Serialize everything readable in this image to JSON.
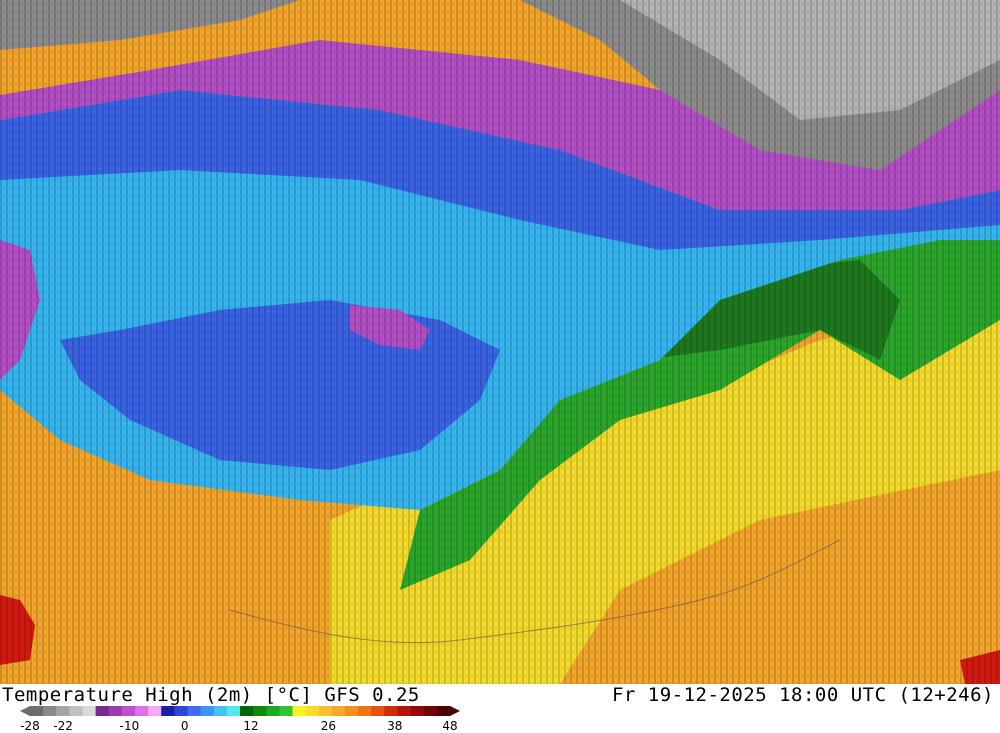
{
  "map": {
    "title": "Temperature High (2m) [°C] GFS 0.25",
    "datetime": "Fr 19-12-2025 18:00 UTC (12+246)"
  },
  "legend": {
    "tick_labels": [
      "-28",
      "-22",
      "-10",
      "0",
      "12",
      "26",
      "38",
      "48"
    ],
    "colors": [
      "#6e6e6e",
      "#8a8a8a",
      "#a5a5a5",
      "#c0c0c0",
      "#d9d9d9",
      "#7a2a8c",
      "#9b3bb0",
      "#c050d0",
      "#e070e8",
      "#f7a8f7",
      "#1c20a8",
      "#2a46d8",
      "#3f6ef2",
      "#3d95f7",
      "#44c4f5",
      "#4ee8ee",
      "#006400",
      "#0f8a0f",
      "#1ea81e",
      "#33c433",
      "#f5f51e",
      "#f7dc2a",
      "#f7c02c",
      "#f7a82a",
      "#f58f1e",
      "#f07414",
      "#e8500f",
      "#d42a0c",
      "#b8130a",
      "#960808",
      "#700404",
      "#4a0000"
    ]
  },
  "colors": {
    "cold_grey": "#8c8c8c",
    "purple": "#b44fc8",
    "blue": "#3b63e6",
    "light_blue": "#35b6f0",
    "green": "#1f7a1f",
    "light_green": "#2ba82b",
    "yellow": "#f5dc2a",
    "orange": "#f4a52a",
    "red": "#d41a10"
  }
}
